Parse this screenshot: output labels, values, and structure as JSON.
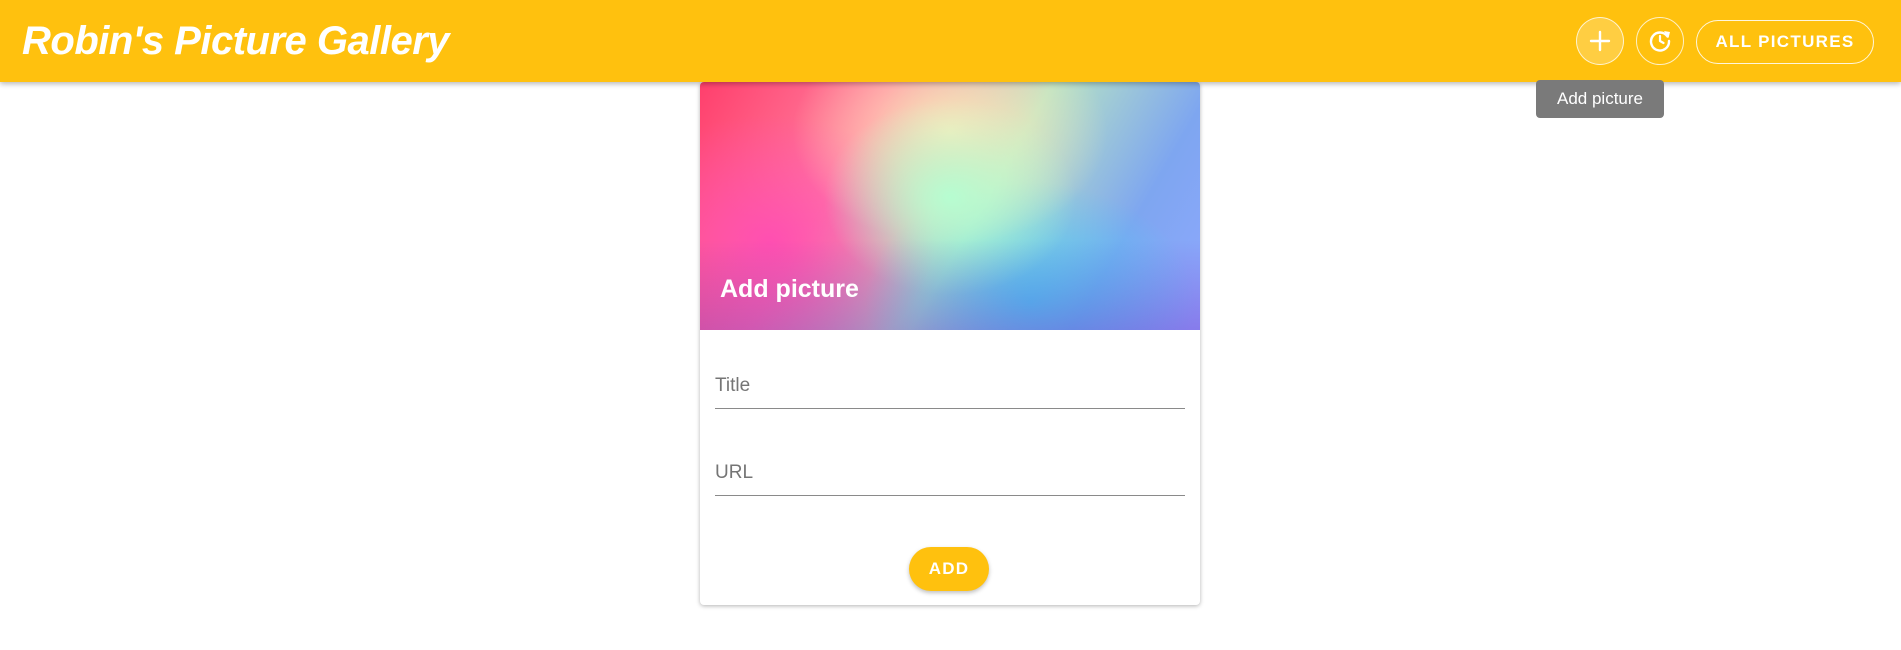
{
  "app": {
    "title": "Robin's Picture Gallery",
    "accent_color": "#ffc10e"
  },
  "toolbar": {
    "add_icon": "plus-icon",
    "refresh_icon": "refresh-icon",
    "all_pictures_label": "ALL PICTURES"
  },
  "tooltip": {
    "text": "Add picture"
  },
  "card": {
    "header": "Add picture",
    "title_placeholder": "Title",
    "url_placeholder": "URL",
    "add_label": "ADD"
  }
}
